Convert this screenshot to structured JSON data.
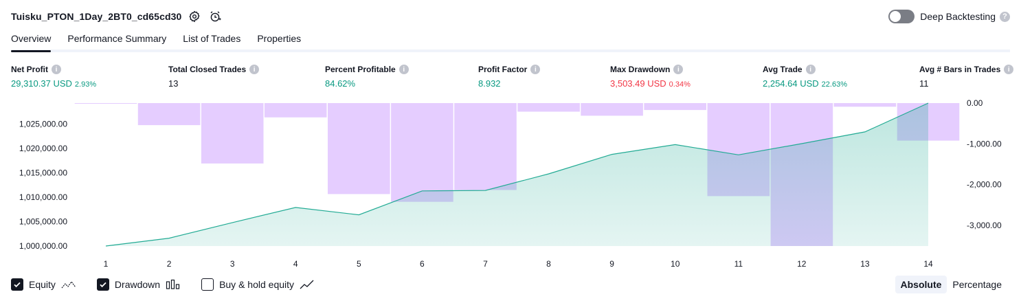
{
  "header": {
    "title": "Tuisku_PTON_1Day_2BT0_cd65cd30",
    "icons": [
      "settings-icon",
      "alarm-add-icon"
    ]
  },
  "deep_backtesting": {
    "label": "Deep Backtesting",
    "enabled": false,
    "help_glyph": "?"
  },
  "tabs": [
    {
      "label": "Overview",
      "active": true
    },
    {
      "label": "Performance Summary",
      "active": false
    },
    {
      "label": "List of Trades",
      "active": false
    },
    {
      "label": "Properties",
      "active": false
    }
  ],
  "metrics": [
    {
      "label": "Net Profit",
      "value": "29,310.37 USD",
      "sub": "2.93%",
      "color": "green"
    },
    {
      "label": "Total Closed Trades",
      "value": "13",
      "sub": "",
      "color": "dark"
    },
    {
      "label": "Percent Profitable",
      "value": "84.62%",
      "sub": "",
      "color": "green"
    },
    {
      "label": "Profit Factor",
      "value": "8.932",
      "sub": "",
      "color": "green"
    },
    {
      "label": "Max Drawdown",
      "value": "3,503.49 USD",
      "sub": "0.34%",
      "color": "red"
    },
    {
      "label": "Avg Trade",
      "value": "2,254.64 USD",
      "sub": "22.63%",
      "color": "green"
    },
    {
      "label": "Avg # Bars in Trades",
      "value": "11",
      "sub": "",
      "color": "dark"
    }
  ],
  "info_glyph": "i",
  "chart_data": {
    "type": "bar",
    "categories": [
      "1",
      "2",
      "3",
      "4",
      "5",
      "6",
      "7",
      "8",
      "9",
      "10",
      "11",
      "12",
      "13",
      "14"
    ],
    "series": [
      {
        "name": "Equity",
        "type": "area",
        "axis": "left",
        "color": "#22ab94",
        "values": [
          1000000,
          1001600,
          1004800,
          1007900,
          1006400,
          1011300,
          1011400,
          1014800,
          1018800,
          1020800,
          1018700,
          1021000,
          1023400,
          1029310.37
        ]
      },
      {
        "name": "Drawdown",
        "type": "bar",
        "axis": "right",
        "color": "#e1c4ff",
        "values": [
          -10,
          -540,
          -1480,
          -350,
          -2230,
          -2420,
          -2130,
          -210,
          -310,
          -170,
          -2280,
          -3503.49,
          -90,
          -920
        ]
      }
    ],
    "left_axis": {
      "ticks": [
        "1,000,000.00",
        "1,005,000.00",
        "1,010,000.00",
        "1,015,000.00",
        "1,020,000.00",
        "1,025,000.00"
      ],
      "tick_values": [
        1000000,
        1005000,
        1010000,
        1015000,
        1020000,
        1025000
      ],
      "range": [
        1000000,
        1029310.37
      ]
    },
    "right_axis": {
      "ticks": [
        "0.00",
        "-1,000.00",
        "-2,000.00",
        "-3,000.00"
      ],
      "tick_values": [
        0,
        -1000,
        -2000,
        -3000
      ],
      "range": [
        -3503.49,
        0
      ]
    },
    "grid": false
  },
  "legend": [
    {
      "label": "Equity",
      "checked": true,
      "icon": "equity-line-icon"
    },
    {
      "label": "Drawdown",
      "checked": true,
      "icon": "drawdown-bars-icon"
    },
    {
      "label": "Buy & hold equity",
      "checked": false,
      "icon": "buy-hold-line-icon"
    }
  ],
  "scale_toggle": {
    "options": [
      "Absolute",
      "Percentage"
    ],
    "selected": "Absolute"
  },
  "colors": {
    "equity": "#22ab94",
    "drawdown": "#e1c4ff",
    "positive": "#089981",
    "negative": "#f23645"
  }
}
